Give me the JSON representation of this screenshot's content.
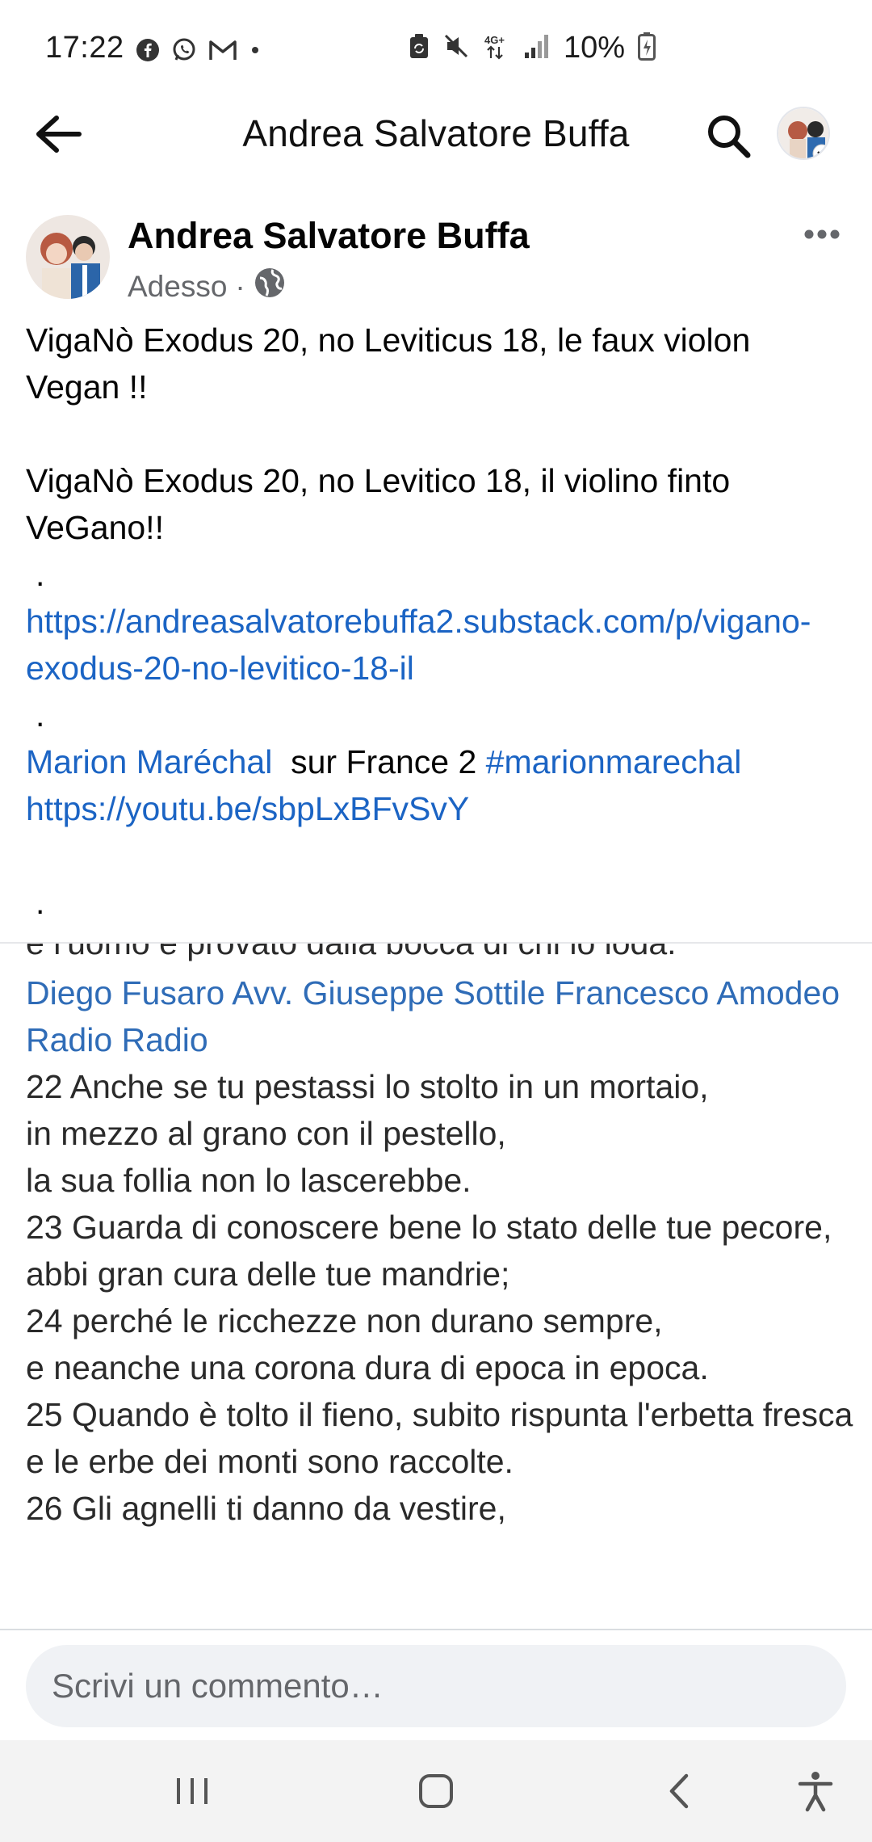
{
  "status_bar": {
    "time": "17:22",
    "left_icons": [
      "facebook-icon",
      "whatsapp-icon",
      "gmail-icon",
      "dot-icon"
    ],
    "right_icons": [
      "sync-icon",
      "mute-icon",
      "4g-icon",
      "signal-icon"
    ],
    "battery_percent": "10%"
  },
  "header": {
    "title": "Andrea Salvatore Buffa"
  },
  "post": {
    "author": "Andrea Salvatore Buffa",
    "timestamp": "Adesso",
    "separator": "·",
    "privacy_icon": "globe-icon",
    "line1": "VigaNò Exodus 20, no Leviticus 18, le faux violon Vegan !!",
    "line2": "VigaNò Exodus 20, no Levitico 18, il violino finto VeGano!!",
    "dot": ".",
    "link1": "https://andreasalvatorebuffa2.substack.com/p/vigano-exodus-20-no-levitico-18-il",
    "mention": "Marion Maréchal",
    "mention_suffix": "  sur France 2 ",
    "hashtag": "#marionmarechal",
    "link2": "https://youtu.be/sbpLxBFvSvY"
  },
  "image_text": {
    "cut_top": "e l'uomo è provato dalla bocca di chi lo loda.",
    "tags": "Diego Fusaro Avv. Giuseppe Sottile Francesco Amodeo Radio Radio",
    "lines": [
      "22  Anche se tu pestassi lo stolto in un mortaio,",
      "in mezzo al grano con il pestello,",
      "la sua follia non lo lascerebbe.",
      "23  Guarda di conoscere bene lo stato delle tue pecore,",
      "abbi gran cura delle tue mandrie;",
      "24  perché le ricchezze non durano sempre,",
      "e neanche una corona dura di epoca in epoca.",
      "25  Quando è tolto il fieno, subito rispunta l'erbetta fresca",
      "e le erbe dei monti sono raccolte.",
      "26  Gli agnelli ti danno da vestire,"
    ]
  },
  "comment": {
    "placeholder": "Scrivi un commento…"
  },
  "nav": {
    "recents": "recents-icon",
    "home": "home-icon",
    "back": "back-icon",
    "accessibility": "accessibility-icon"
  },
  "colors": {
    "link": "#1b64c4",
    "meta": "#65676b",
    "input_bg": "#f0f2f5"
  }
}
